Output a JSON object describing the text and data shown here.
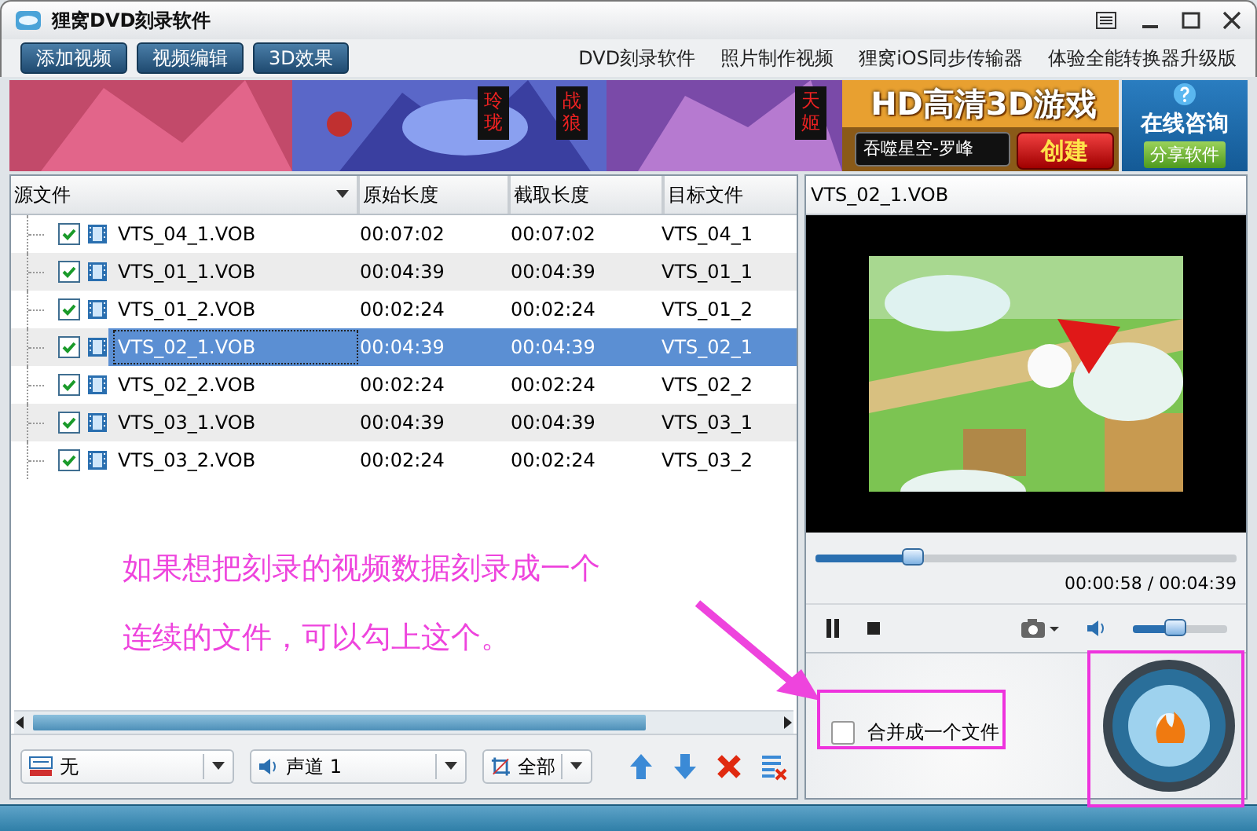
{
  "window": {
    "title": "狸窝DVD刻录软件"
  },
  "toolbar": {
    "buttons": [
      "添加视频",
      "视频编辑",
      "3D效果"
    ],
    "links": [
      "DVD刻录软件",
      "照片制作视频",
      "狸窝iOS同步传输器",
      "体验全能转换器升级版"
    ]
  },
  "banner": {
    "kind": "picture",
    "tags": [
      "玲珑",
      "战狼",
      "天姬"
    ],
    "headline": "HD高清3D游戏",
    "game_field": "吞噬星空-罗峰",
    "create_button": "创建",
    "consult": "在线咨询",
    "share_button": "分享软件"
  },
  "file_list": {
    "columns": [
      "源文件",
      "原始长度",
      "截取长度",
      "目标文件"
    ],
    "rows": [
      {
        "name": "VTS_04_1.VOB",
        "original": "00:07:02",
        "clipped": "00:07:02",
        "target": "VTS_04_1",
        "checked": true,
        "selected": false
      },
      {
        "name": "VTS_01_1.VOB",
        "original": "00:04:39",
        "clipped": "00:04:39",
        "target": "VTS_01_1",
        "checked": true,
        "selected": false
      },
      {
        "name": "VTS_01_2.VOB",
        "original": "00:02:24",
        "clipped": "00:02:24",
        "target": "VTS_01_2",
        "checked": true,
        "selected": false
      },
      {
        "name": "VTS_02_1.VOB",
        "original": "00:04:39",
        "clipped": "00:04:39",
        "target": "VTS_02_1",
        "checked": true,
        "selected": true
      },
      {
        "name": "VTS_02_2.VOB",
        "original": "00:02:24",
        "clipped": "00:02:24",
        "target": "VTS_02_2",
        "checked": true,
        "selected": false
      },
      {
        "name": "VTS_03_1.VOB",
        "original": "00:04:39",
        "clipped": "00:04:39",
        "target": "VTS_03_1",
        "checked": true,
        "selected": false
      },
      {
        "name": "VTS_03_2.VOB",
        "original": "00:02:24",
        "clipped": "00:02:24",
        "target": "VTS_03_2",
        "checked": true,
        "selected": false
      }
    ]
  },
  "player": {
    "file": "VTS_02_1.VOB",
    "progress": {
      "level": 0.23
    },
    "time": "00:00:58 / 00:04:39",
    "playing": true,
    "volume": {
      "level": 0.45
    }
  },
  "annotation": {
    "lines": [
      "如果想把刻录的视频数据刻录成一个",
      "连续的文件，可以勾上这个。"
    ]
  },
  "merge": {
    "label": "合并成一个文件",
    "checked": false
  },
  "bottom": {
    "subtitle": "无",
    "audio": "声道 1",
    "filter": "全部"
  }
}
